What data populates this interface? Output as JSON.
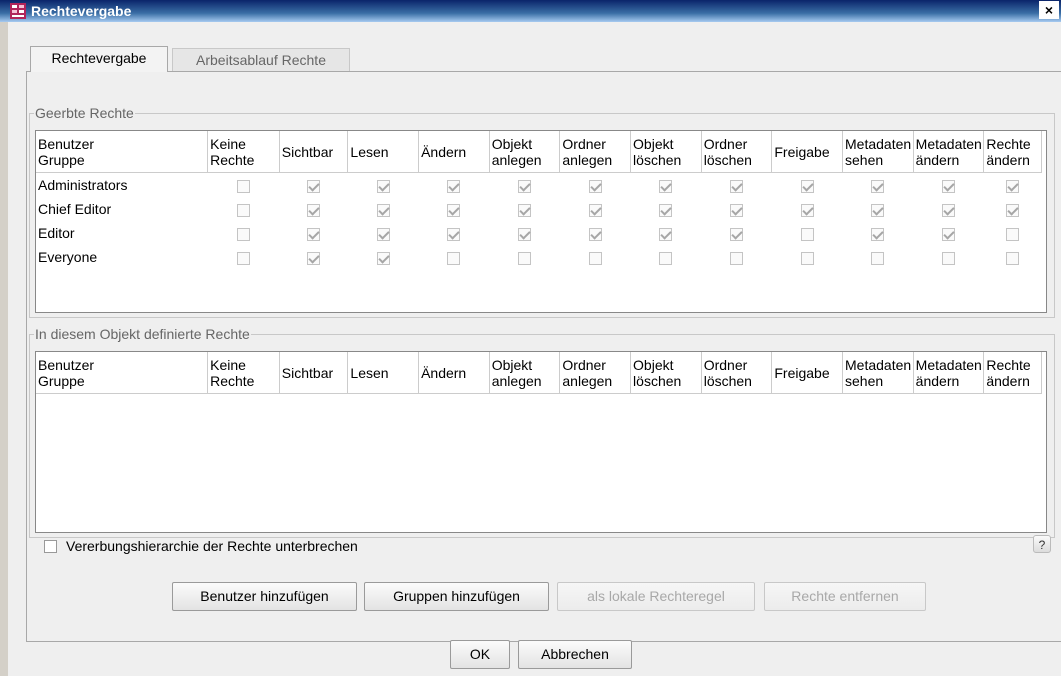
{
  "window": {
    "title": "Rechtevergabe",
    "close_glyph": "×"
  },
  "tabs": [
    {
      "label": "Rechtevergabe",
      "active": true
    },
    {
      "label": "Arbeitsablauf Rechte",
      "active": false
    }
  ],
  "columns": [
    "Benutzer\nGruppe",
    "Keine\nRechte",
    "Sichtbar",
    "Lesen",
    "Ändern",
    "Objekt\nanlegen",
    "Ordner\nanlegen",
    "Objekt\nlöschen",
    "Ordner\nlöschen",
    "Freigabe",
    "Metadaten\nsehen",
    "Metadaten\nändern",
    "Rechte\nändern"
  ],
  "inherited": {
    "legend": "Geerbte Rechte",
    "rows": [
      {
        "name": "Administrators",
        "perms": [
          false,
          true,
          true,
          true,
          true,
          true,
          true,
          true,
          true,
          true,
          true,
          true
        ]
      },
      {
        "name": "Chief Editor",
        "perms": [
          false,
          true,
          true,
          true,
          true,
          true,
          true,
          true,
          true,
          true,
          true,
          true
        ]
      },
      {
        "name": "Editor",
        "perms": [
          false,
          true,
          true,
          true,
          true,
          true,
          true,
          true,
          false,
          true,
          true,
          false
        ]
      },
      {
        "name": "Everyone",
        "perms": [
          false,
          true,
          true,
          false,
          false,
          false,
          false,
          false,
          false,
          false,
          false,
          false
        ]
      }
    ]
  },
  "defined": {
    "legend": "In diesem Objekt definierte Rechte",
    "rows": []
  },
  "inherit_break_label": "Vererbungshierarchie der Rechte unterbrechen",
  "help_label": "?",
  "buttons": {
    "add_user": "Benutzer hinzufügen",
    "add_group": "Gruppen hinzufügen",
    "local_rule": "als lokale Rechteregel",
    "remove": "Rechte entfernen",
    "ok": "OK",
    "cancel": "Abbrechen"
  },
  "colors": {
    "titlebar": "#0a246a",
    "window_bg": "#efefef"
  },
  "icons": {
    "app": "app-icon",
    "help": "help-icon",
    "close": "close-icon"
  }
}
